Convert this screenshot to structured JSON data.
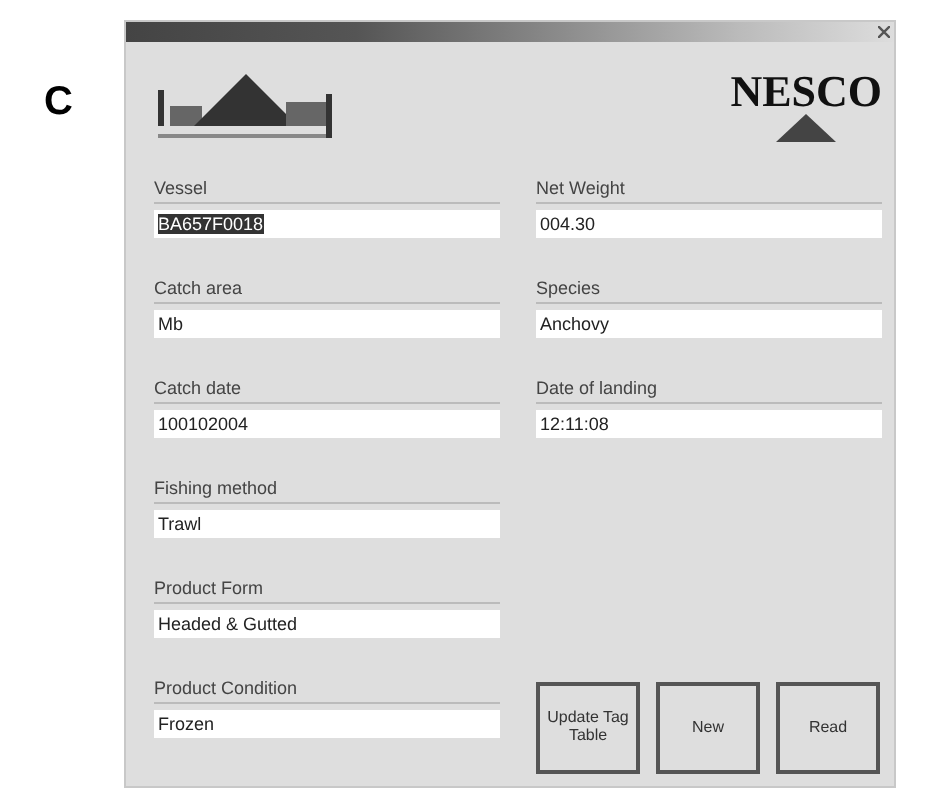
{
  "panel_label": "C",
  "window": {
    "logo_right": "NESCO"
  },
  "fields_left": [
    {
      "label": "Vessel",
      "value": "BA657F0018",
      "highlighted": true
    },
    {
      "label": "Catch area",
      "value": "Mb",
      "highlighted": false
    },
    {
      "label": "Catch date",
      "value": "100102004",
      "highlighted": false
    },
    {
      "label": "Fishing method",
      "value": "Trawl",
      "highlighted": false
    },
    {
      "label": "Product Form",
      "value": "Headed & Gutted",
      "highlighted": false
    },
    {
      "label": "Product Condition",
      "value": "Frozen",
      "highlighted": false
    }
  ],
  "fields_right": [
    {
      "label": "Net Weight",
      "value": "004.30",
      "highlighted": false
    },
    {
      "label": "Species",
      "value": "Anchovy",
      "highlighted": false
    },
    {
      "label": "Date of landing",
      "value": "12:11:08",
      "highlighted": false
    }
  ],
  "buttons": [
    "Update Tag Table",
    "New",
    "Read"
  ]
}
